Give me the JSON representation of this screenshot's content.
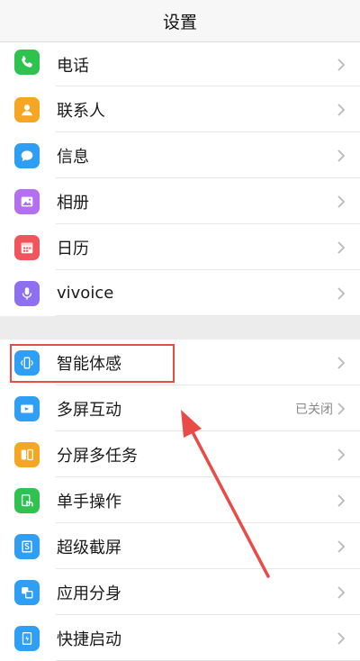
{
  "header": {
    "title": "设置"
  },
  "group1": [
    {
      "label": "电话",
      "icon": "phone-icon",
      "color": "#2fc24f"
    },
    {
      "label": "联系人",
      "icon": "contacts-icon",
      "color": "#f6a623"
    },
    {
      "label": "信息",
      "icon": "message-icon",
      "color": "#2e9df4"
    },
    {
      "label": "相册",
      "icon": "album-icon",
      "color": "#b46ff0"
    },
    {
      "label": "日历",
      "icon": "calendar-icon",
      "color": "#f0555c"
    },
    {
      "label": "vivoice",
      "icon": "microphone-icon",
      "color": "#8d6ff0"
    }
  ],
  "group2": [
    {
      "label": "智能体感",
      "icon": "motion-sense-icon",
      "color": "#2f9ef5",
      "status": ""
    },
    {
      "label": "多屏互动",
      "icon": "multiscreen-icon",
      "color": "#2f9ef5",
      "status": "已关闭"
    },
    {
      "label": "分屏多任务",
      "icon": "split-screen-icon",
      "color": "#f6a623",
      "status": ""
    },
    {
      "label": "单手操作",
      "icon": "one-hand-icon",
      "color": "#2fc24f",
      "status": ""
    },
    {
      "label": "超级截屏",
      "icon": "screenshot-icon",
      "color": "#2f9ef5",
      "status": ""
    },
    {
      "label": "应用分身",
      "icon": "app-clone-icon",
      "color": "#2f9ef5",
      "status": ""
    },
    {
      "label": "快捷启动",
      "icon": "quick-launch-icon",
      "color": "#2f9ef5",
      "status": ""
    }
  ],
  "annotation": {
    "highlight_color": "#e84b48"
  }
}
